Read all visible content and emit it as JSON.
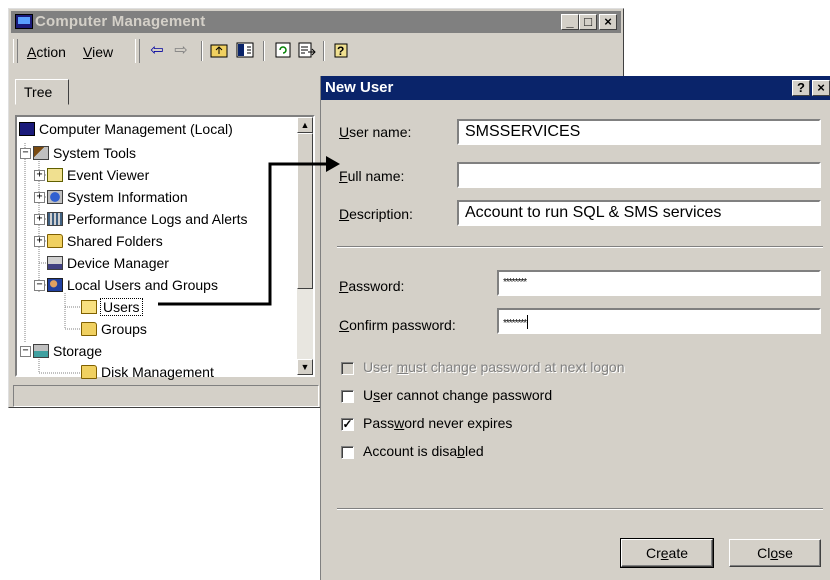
{
  "cm_window": {
    "title": "Computer Management",
    "controls": {
      "minimize": "_",
      "maximize": "□",
      "close": "×"
    },
    "menu": [
      {
        "pre": "",
        "u": "A",
        "post": "ction"
      },
      {
        "pre": "",
        "u": "V",
        "post": "iew"
      }
    ],
    "toolbar_icons": [
      "back-arrow-icon",
      "forward-arrow-icon",
      "up-folder-icon",
      "show-hide-tree-icon",
      "refresh-icon",
      "export-list-icon",
      "help-icon"
    ],
    "tree_tab": "Tree",
    "tree": [
      {
        "label": "Computer Management (Local)",
        "icon": "computer-icon"
      },
      {
        "label": "System Tools",
        "icon": "system-tools-icon"
      },
      {
        "label": "Event Viewer",
        "icon": "event-viewer-icon"
      },
      {
        "label": "System Information",
        "icon": "system-information-icon"
      },
      {
        "label": "Performance Logs and Alerts",
        "icon": "performance-logs-icon"
      },
      {
        "label": "Shared Folders",
        "icon": "shared-folders-icon"
      },
      {
        "label": "Device Manager",
        "icon": "device-manager-icon"
      },
      {
        "label": "Local Users and Groups",
        "icon": "local-users-icon"
      },
      {
        "label": "Users",
        "icon": "folder-open-icon"
      },
      {
        "label": "Groups",
        "icon": "folder-icon"
      },
      {
        "label": "Storage",
        "icon": "storage-icon"
      },
      {
        "label": "Disk Management",
        "icon": "folder-icon"
      }
    ]
  },
  "new_user": {
    "title": "New User",
    "help_btn": "?",
    "close_btn": "×",
    "user_name_label": {
      "u": "U",
      "post": "ser name:"
    },
    "user_name_value": "SMSSERVICES",
    "full_name_label": {
      "u": "F",
      "post": "ull name:"
    },
    "full_name_value": "",
    "description_label": {
      "u": "D",
      "post": "escription:"
    },
    "description_value": "Account to run SQL & SMS services",
    "password_label": {
      "u": "P",
      "post": "assword:"
    },
    "password_value": "********",
    "confirm_label": {
      "u": "C",
      "post": "onfirm password:"
    },
    "confirm_value": "********",
    "checkboxes": [
      {
        "pre": "User ",
        "u": "m",
        "post": "ust change password at next logon",
        "checked": false,
        "disabled": true
      },
      {
        "pre": "U",
        "u": "s",
        "post": "er cannot change password",
        "checked": false,
        "disabled": false
      },
      {
        "pre": "Pass",
        "u": "w",
        "post": "ord never expires",
        "checked": true,
        "disabled": false
      },
      {
        "pre": "Account is disa",
        "u": "b",
        "post": "led",
        "checked": false,
        "disabled": false
      }
    ],
    "create_btn": {
      "pre": "Cr",
      "u": "e",
      "post": "ate"
    },
    "close_button": {
      "pre": "Cl",
      "u": "o",
      "post": "se"
    },
    "check_mark": "✓"
  }
}
